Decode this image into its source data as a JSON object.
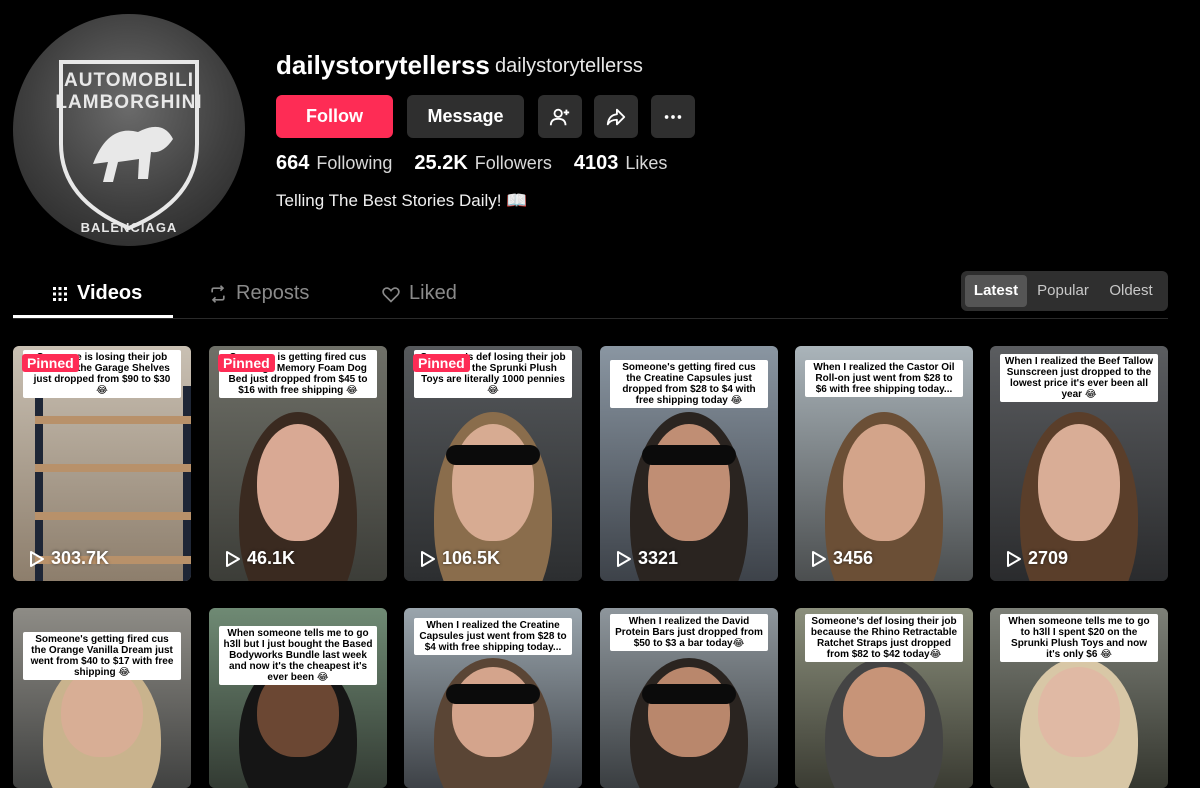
{
  "profile": {
    "username": "dailystorytellerss",
    "nickname": "dailystorytellerss",
    "avatar_text_top": "AUTOMOBILI LAMBORGHINI",
    "avatar_text_bottom": "BALENCIAGA",
    "bio": "Telling The Best Stories Daily! 📖"
  },
  "actions": {
    "follow": "Follow",
    "message": "Message",
    "add_friend_icon": "add-friend-icon",
    "share_icon": "share-icon",
    "more_icon": "more-icon"
  },
  "stats": [
    {
      "value": "664",
      "label": "Following"
    },
    {
      "value": "25.2K",
      "label": "Followers"
    },
    {
      "value": "4103",
      "label": "Likes"
    }
  ],
  "tabs": [
    {
      "label": "Videos",
      "icon": "grid-icon"
    },
    {
      "label": "Reposts",
      "icon": "repost-icon"
    },
    {
      "label": "Liked",
      "icon": "heart-icon"
    }
  ],
  "sort": [
    "Latest",
    "Popular",
    "Oldest"
  ],
  "sort_active": "Latest",
  "pinned_label": "Pinned",
  "videos": [
    {
      "caption": "Someone is losing their job because the Garage Shelves just dropped from $90 to $30 😂",
      "views": "303.7K",
      "pinned": true
    },
    {
      "caption": "Someone is getting fired cus the Large Memory Foam Dog Bed just dropped from $45 to $16 with free shipping 😂",
      "views": "46.1K",
      "pinned": true
    },
    {
      "caption": "Someone's def losing their job because the Sprunki Plush Toys are literally 1000 pennies 😂",
      "views": "106.5K",
      "pinned": true
    },
    {
      "caption": "Someone's getting fired cus the Creatine Capsules just dropped from $28 to $4 with free shipping today 😂",
      "views": "3321",
      "pinned": false
    },
    {
      "caption": "When I realized the Castor Oil Roll-on just went from $28 to $6 with free shipping today...",
      "views": "3456",
      "pinned": false
    },
    {
      "caption": "When I realized the Beef Tallow Sunscreen just dropped to the lowest price it's ever been all year 😂",
      "views": "2709",
      "pinned": false
    },
    {
      "caption": "Someone's getting fired cus the Orange Vanilla Dream just went from $40 to $17 with free shipping 😂",
      "views": "",
      "pinned": false
    },
    {
      "caption": "When someone tells me to go h3ll but I just bought the Based Bodyworks Bundle last week and now it's the cheapest it's ever been 😂",
      "views": "",
      "pinned": false
    },
    {
      "caption": "When I realized the Creatine Capsules just went from $28 to $4 with free shipping today...",
      "views": "",
      "pinned": false
    },
    {
      "caption": "When I realized the David Protein Bars just dropped from $50 to $3 a bar today😂",
      "views": "",
      "pinned": false
    },
    {
      "caption": "Someone's def losing their job because the Rhino Retractable Ratchet Straps just dropped from $82 to $42 today😂",
      "views": "",
      "pinned": false
    },
    {
      "caption": "When someone tells me to go to h3ll I spent $20 on the Sprunki Plush Toys and now it's only $6 😂",
      "views": "",
      "pinned": false
    }
  ],
  "colors": {
    "accent": "#fe2c55",
    "button_bg": "#2f2f2f",
    "background": "#000000"
  }
}
